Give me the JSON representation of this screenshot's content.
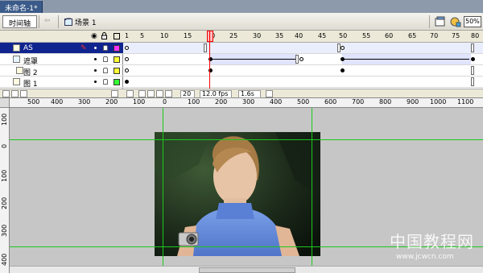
{
  "document": {
    "tab_title": "未命名-1*"
  },
  "toolbar": {
    "timeline_label": "时间轴",
    "back_icon": "back-arrow-icon",
    "scene_icon": "scene-icon",
    "scene_label": "场景 1",
    "edit_symbols_icon": "edit-symbols-icon",
    "edit_scene_icon": "edit-scene-icon",
    "zoom_value": "50%"
  },
  "timeline": {
    "header_icons": [
      "eye-icon",
      "lock-icon",
      "outline-icon"
    ],
    "frame_numbers": [
      "1",
      "5",
      "10",
      "15",
      "20",
      "25",
      "30",
      "35",
      "40",
      "45",
      "50",
      "55",
      "60",
      "65",
      "70",
      "75",
      "80"
    ],
    "layers": [
      {
        "name": "AS",
        "color": "#ff33ff",
        "selected": true,
        "icon": "layer-icon"
      },
      {
        "name": "遮罩",
        "color": "#ffff33",
        "selected": false,
        "icon": "mask-layer-icon"
      },
      {
        "name": "图 2",
        "color": "#ffff33",
        "selected": false,
        "icon": "masked-layer-icon"
      },
      {
        "name": "图 1",
        "color": "#33ff33",
        "selected": false,
        "icon": "layer-icon"
      }
    ],
    "current_frame": "20",
    "frame_rate": "12.0 fps",
    "elapsed_time": "1.6s"
  },
  "rulers": {
    "horizontal": [
      "500",
      "400",
      "300",
      "200",
      "100",
      "0",
      "100",
      "200",
      "300",
      "400",
      "500",
      "600",
      "700",
      "800",
      "900",
      "1000",
      "1100"
    ],
    "vertical": [
      "100",
      "0",
      "100",
      "200",
      "300",
      "400"
    ]
  },
  "stage": {
    "photo_description_icon": "photo-of-woman-with-camera",
    "guide_color": "#1ec81e"
  },
  "watermark": {
    "title": "中国教程网",
    "url": "www.jcwcn.com"
  }
}
